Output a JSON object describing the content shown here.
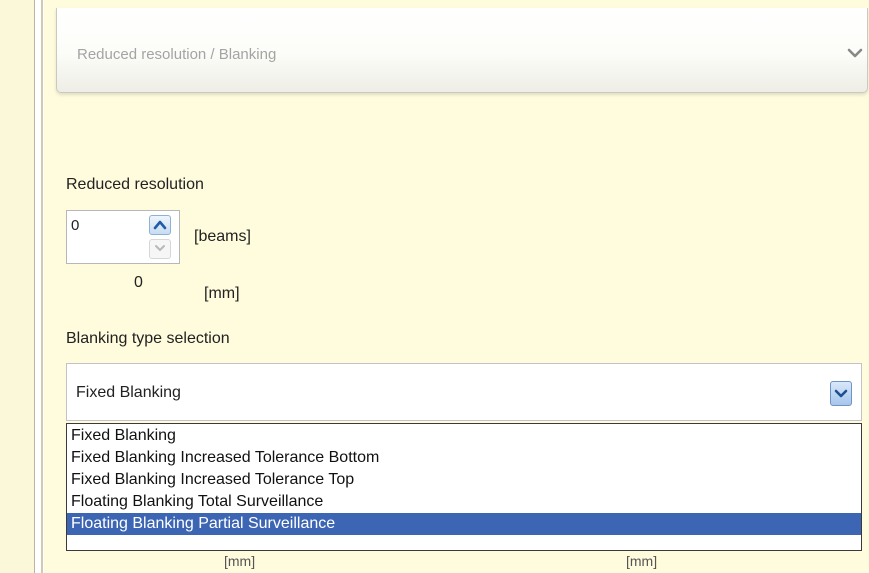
{
  "section": {
    "title": "Reduced resolution / Blanking",
    "chevron_icon": "chevron-down-icon"
  },
  "reduced_resolution": {
    "label": "Reduced resolution",
    "beams_value": "0",
    "beams_unit": "[beams]",
    "mm_value": "0",
    "mm_unit": "[mm]",
    "up_icon": "arrow-up-icon",
    "down_icon": "arrow-down-icon"
  },
  "blanking": {
    "label": "Blanking type selection",
    "selected": "Fixed Blanking",
    "dropdown_icon": "chevron-down-icon",
    "options": [
      {
        "label": "Fixed Blanking",
        "highlighted": false
      },
      {
        "label": "Fixed Blanking Increased Tolerance Bottom",
        "highlighted": false
      },
      {
        "label": "Fixed Blanking Increased Tolerance Top",
        "highlighted": false
      },
      {
        "label": "Floating Blanking Total Surveillance",
        "highlighted": false
      },
      {
        "label": "Floating Blanking Partial Surveillance",
        "highlighted": true
      }
    ]
  },
  "below_dropdown": {
    "unit_left": "[mm]",
    "unit_right": "[mm]"
  },
  "colors": {
    "panel_background": "#fffbdd",
    "selection": "#3c66b3",
    "combo_button": "#a6c6ec"
  }
}
